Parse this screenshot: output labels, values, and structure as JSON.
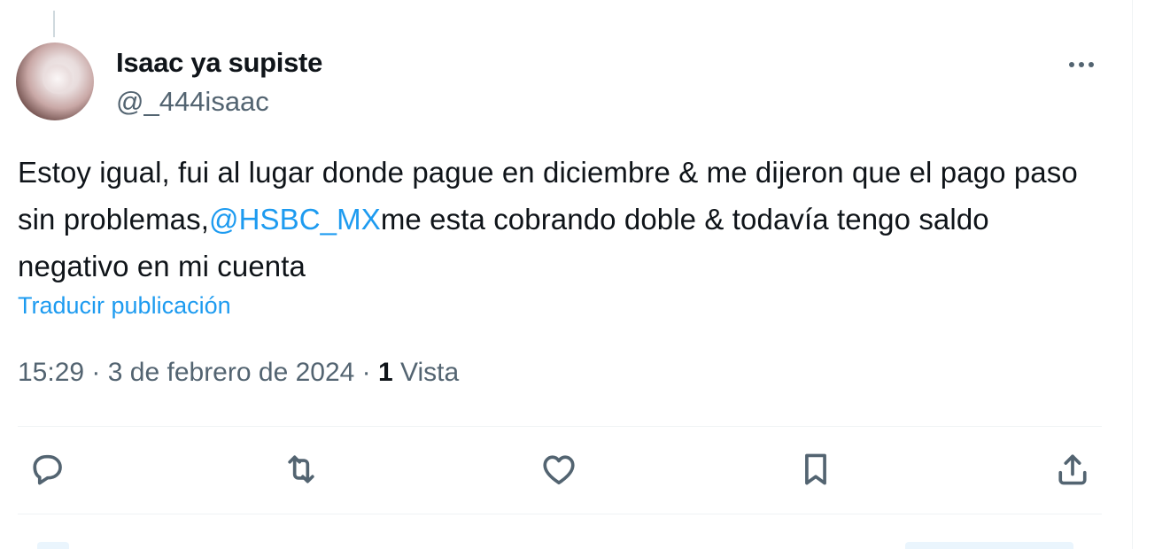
{
  "author": {
    "display_name": "Isaac ya supiste",
    "handle": "@_444isaac",
    "avatar": "profile-photo"
  },
  "tweet": {
    "text_part1": "Estoy igual, fui al lugar donde pague en diciembre & me dijeron que el pago paso sin problemas,",
    "mention": "@HSBC_MX",
    "text_part2": "me esta cobrando doble & todavía tengo saldo negativo en mi cuenta",
    "translate_label": "Traducir publicación"
  },
  "meta": {
    "time": "15:29",
    "separator": "·",
    "date": "3 de febrero de 2024",
    "views_count": "1",
    "views_label": "Vista"
  },
  "actions": [
    {
      "name": "reply",
      "icon": "reply-icon"
    },
    {
      "name": "repost",
      "icon": "repost-icon"
    },
    {
      "name": "like",
      "icon": "heart-icon"
    },
    {
      "name": "bookmark",
      "icon": "bookmark-icon"
    },
    {
      "name": "share",
      "icon": "share-icon"
    }
  ],
  "colors": {
    "accent": "#1d9bf0",
    "text_primary": "#0f1419",
    "text_secondary": "#536471",
    "divider": "#eff3f4"
  }
}
